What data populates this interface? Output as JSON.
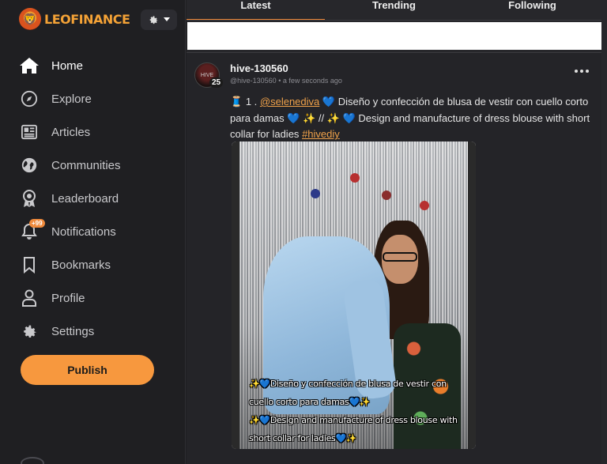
{
  "brand": {
    "name": "LEOFINANCE",
    "accent": "#f7983e"
  },
  "sidebar": {
    "items": [
      {
        "label": "Home",
        "icon": "home-icon"
      },
      {
        "label": "Explore",
        "icon": "compass-icon"
      },
      {
        "label": "Articles",
        "icon": "newspaper-icon"
      },
      {
        "label": "Communities",
        "icon": "globe-icon"
      },
      {
        "label": "Leaderboard",
        "icon": "award-icon"
      },
      {
        "label": "Notifications",
        "icon": "bell-icon",
        "badge": "+99"
      },
      {
        "label": "Bookmarks",
        "icon": "bookmark-icon"
      },
      {
        "label": "Profile",
        "icon": "user-icon"
      },
      {
        "label": "Settings",
        "icon": "gear-icon"
      }
    ],
    "publish_label": "Publish"
  },
  "tabs": [
    {
      "label": "Latest",
      "active": true
    },
    {
      "label": "Trending",
      "active": false
    },
    {
      "label": "Following",
      "active": false
    }
  ],
  "post": {
    "author": "hive-130560",
    "reputation": "25",
    "handle": "@hive-130560",
    "time": "a few seconds ago",
    "text": {
      "prefix": "1 .",
      "mention": "@selenediva",
      "part1": "Diseño y confección de blusa de vestir con cuello corto para damas",
      "part2": "//",
      "part3": "Design and manufacture of dress blouse with short collar for ladies",
      "tag": "#hivediy"
    },
    "image_caption": {
      "line1": "Diseño y confección de blusa de vestir con cuello corto para damas",
      "line2": "Design and manufacture of dress blouse with short collar for ladies"
    }
  }
}
